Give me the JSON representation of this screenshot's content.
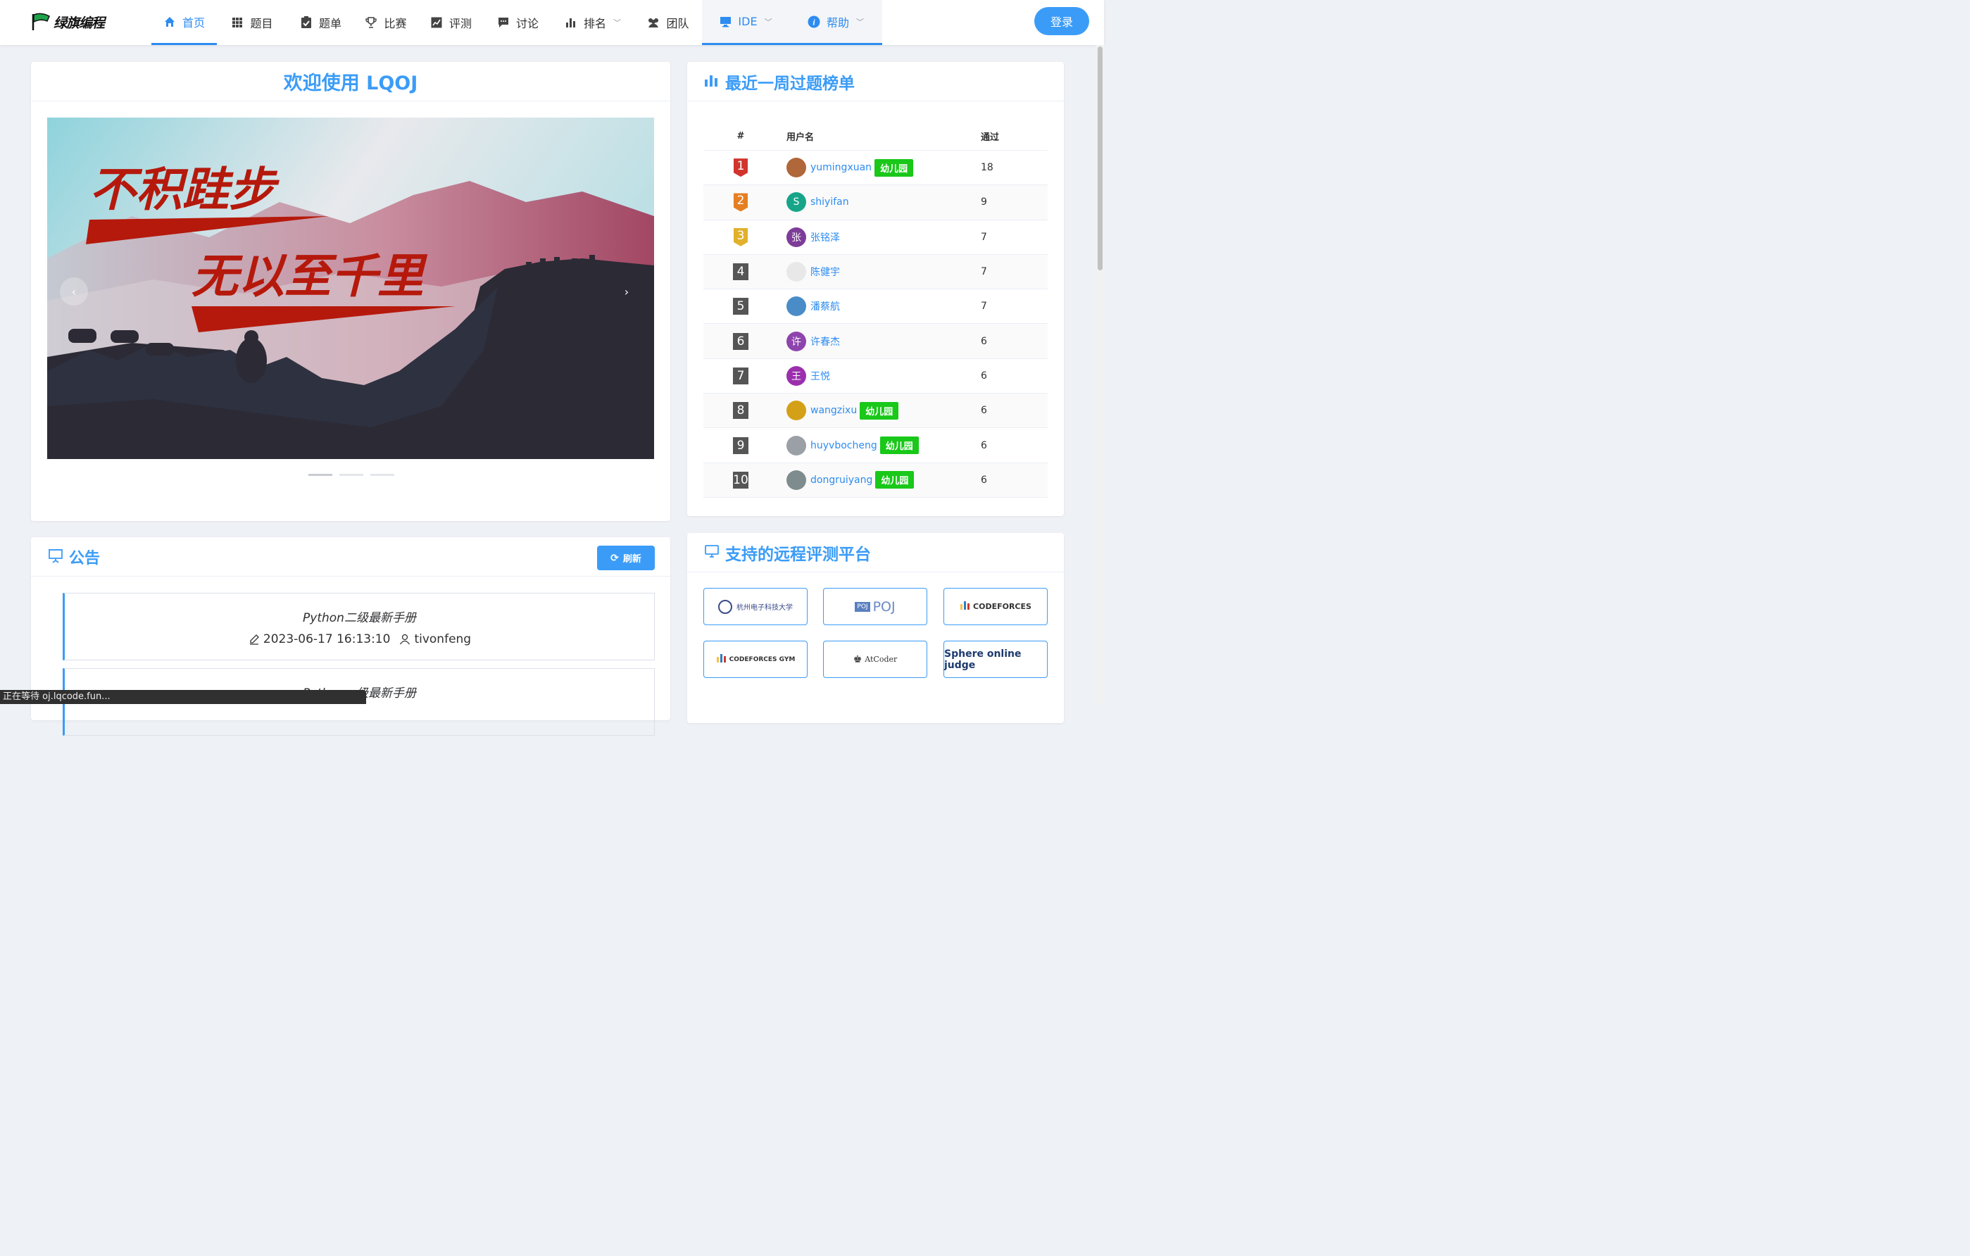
{
  "brand": {
    "logo_text": "绿旗编程",
    "accent": "#3b9cf7"
  },
  "nav": {
    "items": [
      {
        "label": "首页",
        "icon": "home-icon"
      },
      {
        "label": "题目",
        "icon": "grid-icon"
      },
      {
        "label": "题单",
        "icon": "checklist-icon"
      },
      {
        "label": "比赛",
        "icon": "trophy-icon"
      },
      {
        "label": "评测",
        "icon": "chart-line-icon"
      },
      {
        "label": "讨论",
        "icon": "chat-icon"
      },
      {
        "label": "排名",
        "icon": "bar-chart-icon"
      },
      {
        "label": "团队",
        "icon": "team-icon"
      },
      {
        "label": "IDE",
        "icon": "monitor-icon"
      },
      {
        "label": "帮助",
        "icon": "info-icon"
      }
    ],
    "login_label": "登录"
  },
  "welcome": {
    "title": "欢迎使用 LQOJ",
    "banner_line1": "不积跬步",
    "banner_line2": "无以至千里",
    "prev": "‹",
    "next": "›"
  },
  "notice": {
    "title": "公告",
    "refresh_label": "刷新",
    "items": [
      {
        "title": "Python二级最新手册",
        "time": "2023-06-17 16:13:10",
        "author": "tivonfeng"
      },
      {
        "title": "Python一级最新手册"
      }
    ]
  },
  "ranking": {
    "title": "最近一周过题榜单",
    "columns": [
      "#",
      "用户名",
      "通过"
    ],
    "rows": [
      {
        "rank": "1",
        "user": "yumingxuan",
        "tag": "幼儿园",
        "pass": "18"
      },
      {
        "rank": "2",
        "user": "shiyifan",
        "avatar_text": "S",
        "pass": "9"
      },
      {
        "rank": "3",
        "user": "张铭泽",
        "avatar_text": "张",
        "pass": "7"
      },
      {
        "rank": "4",
        "user": "陈健宇",
        "pass": "7"
      },
      {
        "rank": "5",
        "user": "潘蔡航",
        "pass": "7"
      },
      {
        "rank": "6",
        "user": "许春杰",
        "avatar_text": "许",
        "pass": "6"
      },
      {
        "rank": "7",
        "user": "王悦",
        "avatar_text": "王",
        "pass": "6"
      },
      {
        "rank": "8",
        "user": "wangzixu",
        "tag": "幼儿园",
        "pass": "6"
      },
      {
        "rank": "9",
        "user": "huyvbocheng",
        "tag": "幼儿园",
        "pass": "6"
      },
      {
        "rank": "10",
        "user": "dongruiyang",
        "tag": "幼儿园",
        "pass": "6"
      }
    ]
  },
  "remote": {
    "title": "支持的远程评测平台",
    "platforms": [
      "杭州电子科技大学",
      "POJ",
      "CODEFORCES",
      "CODEFORCES GYM",
      "AtCoder",
      "Sphere online judge"
    ]
  },
  "statusbar": {
    "text": "正在等待 oj.lqcode.fun..."
  }
}
